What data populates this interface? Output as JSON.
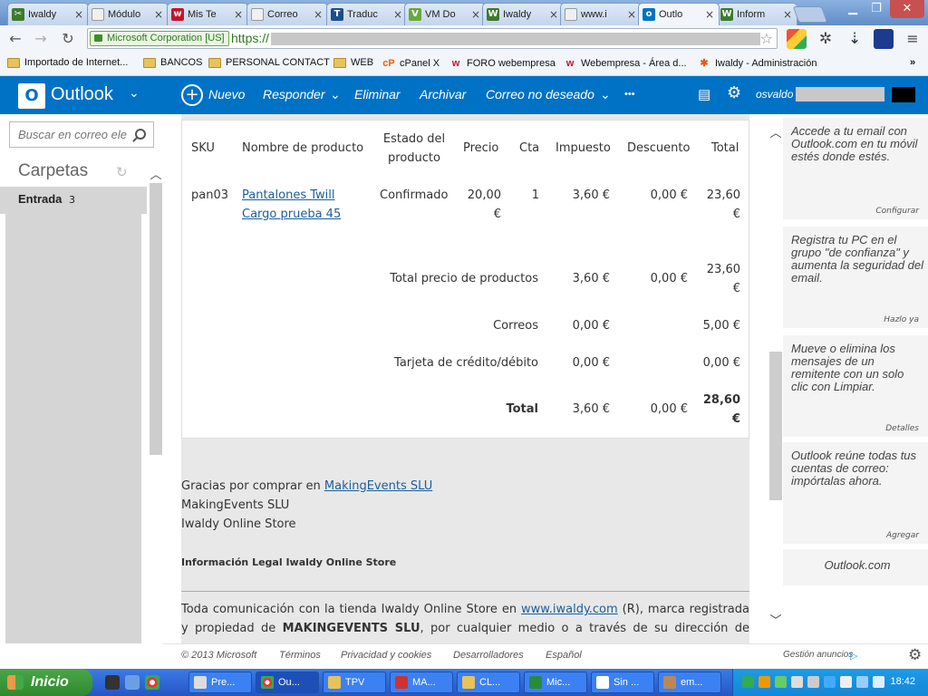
{
  "browser": {
    "tabs": [
      {
        "title": "Iwaldy",
        "icon": "iwaldy-icon",
        "color": "#3a7c2c"
      },
      {
        "title": "Módulo",
        "icon": "page-icon",
        "color": "#888888"
      },
      {
        "title": "Mis Te",
        "icon": "webempresa-icon",
        "color": "#c4152b"
      },
      {
        "title": "Correo",
        "icon": "page-icon",
        "color": "#888888"
      },
      {
        "title": "Traduc",
        "icon": "translate-icon",
        "color": "#1a4f8a"
      },
      {
        "title": "VM Do",
        "icon": "vm-icon",
        "color": "#6aa83a"
      },
      {
        "title": "Iwaldy",
        "icon": "iwaldy-icon",
        "color": "#3a7c2c"
      },
      {
        "title": "www.i",
        "icon": "page-icon",
        "color": "#888888"
      },
      {
        "title": "Outlo",
        "icon": "outlook-icon",
        "color": "#0072c6"
      },
      {
        "title": "Inform",
        "icon": "iwaldy-icon",
        "color": "#3a7c2c"
      }
    ],
    "ev_label": "Microsoft Corporation [US]",
    "url_prefix": "https://",
    "bookmarks": [
      {
        "label": "Importado de Internet...",
        "icon": "folder-icon"
      },
      {
        "label": "BANCOS",
        "icon": "folder-icon"
      },
      {
        "label": "PERSONAL CONTACT",
        "icon": "folder-icon"
      },
      {
        "label": "WEB",
        "icon": "folder-icon"
      },
      {
        "label": "cPanel X",
        "icon": "cpanel-icon"
      },
      {
        "label": "FORO webempresa",
        "icon": "webempresa-icon"
      },
      {
        "label": "Webempresa - Área d...",
        "icon": "webempresa-icon"
      },
      {
        "label": "Iwaldy - Administración",
        "icon": "joomla-icon"
      }
    ],
    "more": "»"
  },
  "outlook": {
    "brand": "Outlook",
    "commands": {
      "new": "Nuevo",
      "reply": "Responder",
      "delete": "Eliminar",
      "archive": "Archivar",
      "junk": "Correo no deseado",
      "more": "•••"
    },
    "user": "osvaldo",
    "search_placeholder": "Buscar en correo ele",
    "folders_title": "Carpetas",
    "inbox_label": "Entrada",
    "inbox_count": "3"
  },
  "order": {
    "headers": [
      "SKU",
      "Nombre de producto",
      "Estado del producto",
      "Precio",
      "Cta",
      "Impuesto",
      "Descuento",
      "Total"
    ],
    "row": {
      "sku": "pan03",
      "name": "Pantalones Twill Cargo prueba 45",
      "state": "Confirmado",
      "price": "20,00 €",
      "qty": "1",
      "tax": "3,60 €",
      "discount": "0,00 €",
      "total": "23,60 €"
    },
    "summary": [
      {
        "label": "Total precio de productos",
        "tax": "3,60 €",
        "discount": "0,00 €",
        "total": "23,60 €"
      },
      {
        "label": "Correos",
        "tax": "0,00 €",
        "discount": "",
        "total": "5,00 €"
      },
      {
        "label": "Tarjeta de crédito/débito",
        "tax": "0,00 €",
        "discount": "",
        "total": "0,00 €"
      },
      {
        "label": "Total",
        "tax": "3,60 €",
        "discount": "0,00 €",
        "total": "28,60 €"
      }
    ]
  },
  "mail_footer": {
    "thanks": "Gracias por comprar en",
    "thanks_link": "MakingEvents SLU",
    "company": "MakingEvents SLU",
    "store": "Iwaldy Online Store",
    "legal_title": "Información Legal Iwaldy Online Store",
    "legal_p1": "Toda comunicación con la tienda Iwaldy Online Store en",
    "legal_link": "www.iwaldy.com",
    "legal_p2": "(R), marca registrada y propiedad de",
    "legal_owner": "MAKINGEVENTS SLU",
    "legal_p3": ", por cualquier medio o a través de su dirección de correo"
  },
  "ads": [
    {
      "text": "Accede a tu email con Outlook.com en tu móvil estés donde estés.",
      "link": "Configurar"
    },
    {
      "text": "Registra tu PC en el grupo \"de confianza\" y aumenta la seguridad del email.",
      "link": "Hazlo ya"
    },
    {
      "text": "Mueve o elimina los mensajes de un remitente con un solo clic con Limpiar.",
      "link": "Detalles"
    },
    {
      "text": "Outlook reúne todas tus cuentas de correo: impórtalas ahora.",
      "link": "Agregar"
    },
    {
      "text": "Outlook.com",
      "link": ""
    }
  ],
  "footer_links": [
    "© 2013 Microsoft",
    "Términos",
    "Privacidad y cookies",
    "Desarrolladores",
    "Español"
  ],
  "ads_manage": "Gestión anuncios",
  "taskbar": {
    "start": "Inicio",
    "tasks": [
      "Pre...",
      "Ou...",
      "TPV",
      "MA...",
      "CL...",
      "Mic...",
      "Sin ...",
      "em..."
    ],
    "clock": "18:42"
  }
}
